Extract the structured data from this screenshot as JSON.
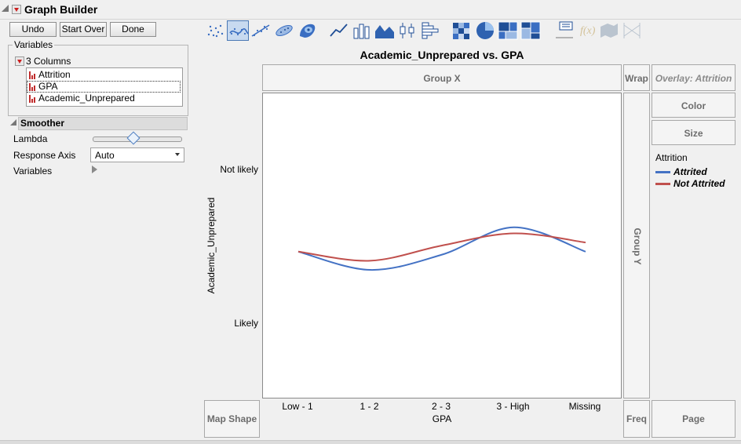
{
  "app": {
    "title": "Graph Builder"
  },
  "controls": {
    "undo": "Undo",
    "start_over": "Start Over",
    "done": "Done"
  },
  "variables_panel": {
    "label": "Variables",
    "group_label": "3 Columns",
    "columns": [
      "Attrition",
      "GPA",
      "Academic_Unprepared"
    ],
    "selected_index": 1
  },
  "smoother": {
    "title": "Smoother",
    "lambda_label": "Lambda",
    "lambda_fraction": 0.42,
    "response_axis_label": "Response Axis",
    "response_axis_value": "Auto",
    "variables_label": "Variables"
  },
  "toolbar": {
    "icons": [
      "points-icon",
      "smoother-icon",
      "line-of-fit-icon",
      "ellipse-icon",
      "contour-icon",
      "line-icon",
      "bar-icon",
      "area-icon",
      "box-plot-icon",
      "histogram-icon",
      "heatmap-icon",
      "pie-icon",
      "treemap-icon",
      "mosaic-icon",
      "caption-box-icon",
      "formula-icon",
      "map-shapes-icon",
      "parallel-icon"
    ],
    "selected": "smoother-icon"
  },
  "graph": {
    "title": "Academic_Unprepared vs. GPA",
    "group_x": "Group X",
    "group_y": "Group Y",
    "wrap": "Wrap",
    "overlay": "Overlay: Attrition",
    "color": "Color",
    "size": "Size",
    "map_shape": "Map Shape",
    "freq": "Freq",
    "page": "Page",
    "legend_title": "Attrition"
  },
  "chart_data": {
    "type": "line",
    "title": "Academic_Unprepared vs. GPA",
    "xlabel": "GPA",
    "ylabel": "Academic_Unprepared",
    "categories": [
      "Low - 1",
      "1 - 2",
      "2 - 3",
      "3 - High",
      "Missing"
    ],
    "y_ticks": [
      "Not likely",
      "Likely"
    ],
    "ylim": [
      0,
      1
    ],
    "series": [
      {
        "name": "Attrited",
        "color": "#4472c4",
        "values": [
          0.48,
          0.42,
          0.47,
          0.56,
          0.48
        ]
      },
      {
        "name": "Not Attrited",
        "color": "#c0504d",
        "values": [
          0.48,
          0.45,
          0.5,
          0.54,
          0.51
        ]
      }
    ],
    "legend_position": "right",
    "grid": false
  }
}
